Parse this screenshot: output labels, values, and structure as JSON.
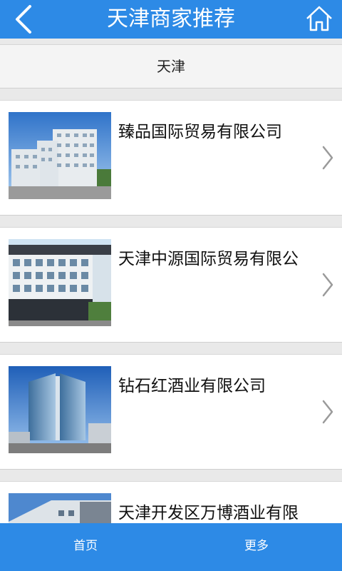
{
  "header": {
    "title": "天津商家推荐",
    "back_icon": "back-chevron-icon",
    "home_icon": "home-icon"
  },
  "location": {
    "label": "天津"
  },
  "items": [
    {
      "name": "臻品国际贸易有限公司"
    },
    {
      "name": "天津中源国际贸易有限公"
    },
    {
      "name": "钻石红酒业有限公司"
    },
    {
      "name": "天津开发区万博酒业有限"
    }
  ],
  "tabbar": {
    "tabs": [
      {
        "label": "首页"
      },
      {
        "label": "更多"
      }
    ]
  },
  "colors": {
    "accent": "#2d8ae6",
    "background": "#e9e9e9"
  }
}
